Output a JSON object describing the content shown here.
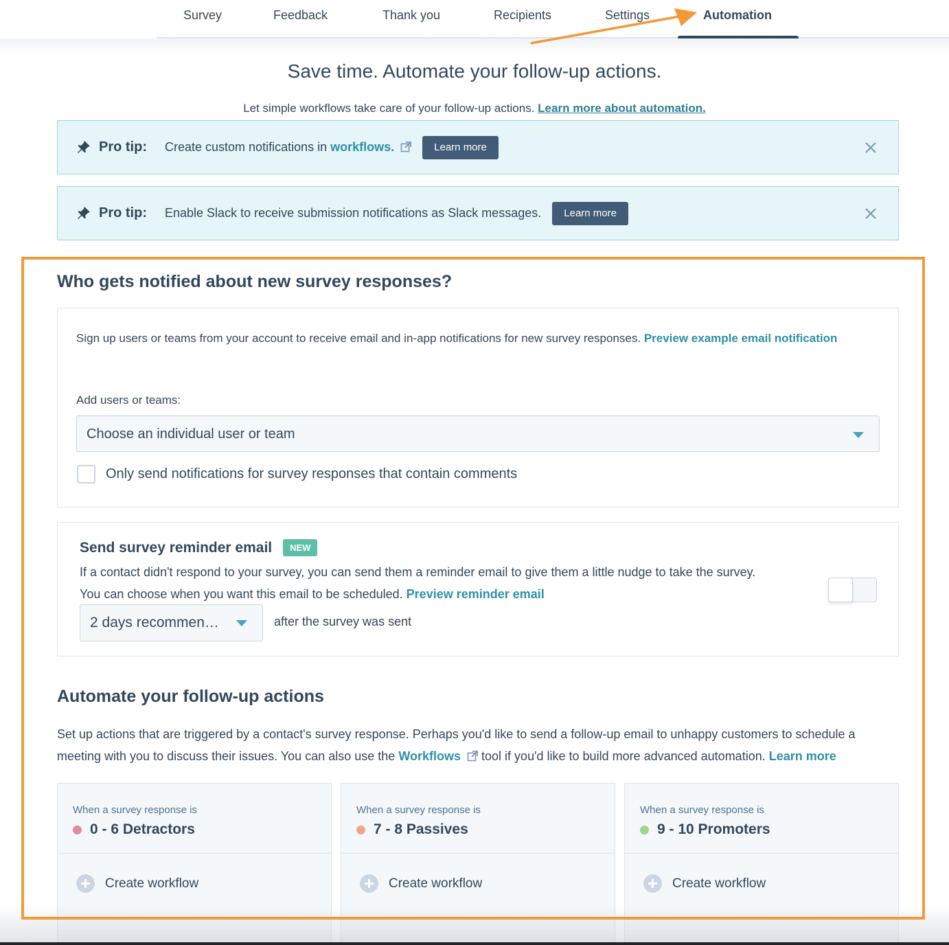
{
  "tabs": [
    {
      "label": "Survey",
      "active": false
    },
    {
      "label": "Feedback",
      "active": false
    },
    {
      "label": "Thank you",
      "active": false
    },
    {
      "label": "Recipients",
      "active": false
    },
    {
      "label": "Settings",
      "active": false
    },
    {
      "label": "Automation",
      "active": true
    }
  ],
  "hero": {
    "title": "Save time. Automate your follow-up actions.",
    "subtitle": "Let simple workflows take care of your follow-up actions.",
    "link": "Learn more about automation."
  },
  "protips": [
    {
      "label": "Pro tip:",
      "text": "Create custom notifications in",
      "link": "workflows.",
      "button": "Learn more",
      "icon": "pin-icon"
    },
    {
      "label": "Pro tip:",
      "text": "Enable Slack to receive submission notifications as Slack messages.",
      "button": "Learn more",
      "icon": "pin-icon"
    }
  ],
  "notify": {
    "heading": "Who gets notified about new survey responses?",
    "description": "Sign up users or teams from your account to receive email and in-app notifications for new survey responses.",
    "preview_link": "Preview example email notification",
    "add_label": "Add users or teams:",
    "select_placeholder": "Choose an individual user or team",
    "checkbox_label": "Only send notifications for survey responses that contain comments",
    "checkbox_checked": false
  },
  "reminder": {
    "title": "Send survey reminder email",
    "badge": "NEW",
    "description": "If a contact didn't respond to your survey, you can send them a reminder email to give them a little nudge to take the survey. You can choose when you want this email to be scheduled.",
    "preview_link": "Preview reminder email",
    "delay_value": "2 days recommen…",
    "after_text": "after the survey was sent",
    "enabled": false
  },
  "automate": {
    "heading": "Automate your follow-up actions",
    "description_1": "Set up actions that are triggered by a contact's survey response. Perhaps you'd like to send a follow-up email to unhappy customers to schedule a meeting with you to discuss their issues. You can also use the",
    "workflows_link": "Workflows",
    "description_2": "tool if you'd like to build more advanced automation.",
    "learn_more": "Learn more",
    "columns": [
      {
        "when": "When a survey response is",
        "category": "0 - 6 Detractors",
        "color": "#e08aa5",
        "action": "Create workflow"
      },
      {
        "when": "When a survey response is",
        "category": "7 - 8 Passives",
        "color": "#f2a58c",
        "action": "Create workflow"
      },
      {
        "when": "When a survey response is",
        "category": "9 - 10 Promoters",
        "color": "#a2d28f",
        "action": "Create workflow"
      }
    ]
  },
  "colors": {
    "annotation": "#f2993a",
    "link": "#2f8fa8",
    "text": "#33475b",
    "button": "#425b76"
  }
}
